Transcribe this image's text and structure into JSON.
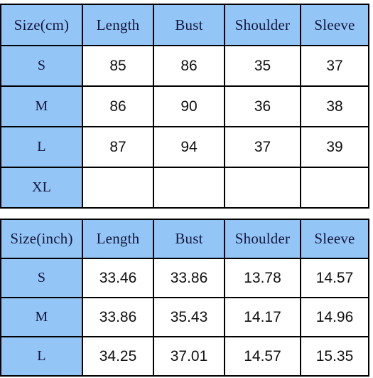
{
  "tables": [
    {
      "id": "size-chart-cm",
      "unit_header": "Size(cm)",
      "columns": [
        "Size(cm)",
        "Length",
        "Bust",
        "Shoulder",
        "Sleeve"
      ],
      "rows": [
        {
          "size": "S",
          "length": "85",
          "bust": "86",
          "shoulder": "35",
          "sleeve": "37"
        },
        {
          "size": "M",
          "length": "86",
          "bust": "90",
          "shoulder": "36",
          "sleeve": "38"
        },
        {
          "size": "L",
          "length": "87",
          "bust": "94",
          "shoulder": "37",
          "sleeve": "39"
        },
        {
          "size": "XL",
          "length": "",
          "bust": "",
          "shoulder": "",
          "sleeve": ""
        }
      ]
    },
    {
      "id": "size-chart-inch",
      "unit_header": "Size(inch)",
      "columns": [
        "Size(inch)",
        "Length",
        "Bust",
        "Shoulder",
        "Sleeve"
      ],
      "rows": [
        {
          "size": "S",
          "length": "33.46",
          "bust": "33.86",
          "shoulder": "13.78",
          "sleeve": "14.57"
        },
        {
          "size": "M",
          "length": "33.86",
          "bust": "35.43",
          "shoulder": "14.17",
          "sleeve": "14.96"
        },
        {
          "size": "L",
          "length": "34.25",
          "bust": "37.01",
          "shoulder": "14.57",
          "sleeve": "15.35"
        }
      ]
    }
  ],
  "colors": {
    "header_fill": "#93c6f7",
    "header_text": "#16163c",
    "cell_fill": "#ffffff",
    "cell_text": "#101010",
    "border": "#000000"
  }
}
